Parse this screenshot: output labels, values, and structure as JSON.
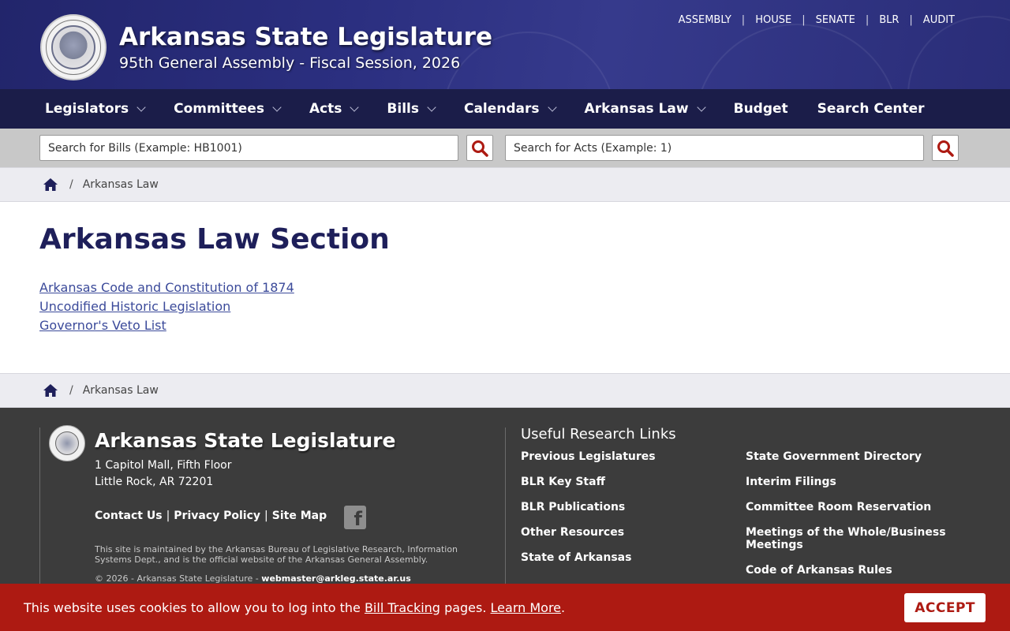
{
  "header": {
    "title": "Arkansas State Legislature",
    "subtitle": "95th General Assembly - Fiscal Session, 2026",
    "top_links": [
      "ASSEMBLY",
      "HOUSE",
      "SENATE",
      "BLR",
      "AUDIT"
    ],
    "colors": {
      "header_bg": "#2b2f80",
      "nav_bg": "#1b1d49"
    }
  },
  "nav": {
    "items": [
      {
        "label": "Legislators",
        "dropdown": true
      },
      {
        "label": "Committees",
        "dropdown": true
      },
      {
        "label": "Acts",
        "dropdown": true
      },
      {
        "label": "Bills",
        "dropdown": true
      },
      {
        "label": "Calendars",
        "dropdown": true
      },
      {
        "label": "Arkansas Law",
        "dropdown": true
      },
      {
        "label": "Budget",
        "dropdown": false
      },
      {
        "label": "Search Center",
        "dropdown": false
      }
    ]
  },
  "search": {
    "bills_placeholder": "Search for Bills (Example: HB1001)",
    "acts_placeholder": "Search for Acts (Example: 1)",
    "button_icon": "search-icon",
    "button_color": "#ad1a12"
  },
  "breadcrumb": {
    "home_icon": "home-icon",
    "current": "Arkansas Law"
  },
  "main": {
    "title": "Arkansas Law Section",
    "links": [
      "Arkansas Code and Constitution of 1874",
      "Uncodified Historic Legislation",
      "Governor's Veto List"
    ]
  },
  "footer": {
    "title": "Arkansas State Legislature",
    "address_line1": "1 Capitol Mall, Fifth Floor",
    "address_line2": "Little Rock, AR 72201",
    "links": [
      "Contact Us",
      "Privacy Policy",
      "Site Map"
    ],
    "social_icon": "facebook-icon",
    "note": "This site is maintained by the Arkansas Bureau of Legislative Research, Information Systems Dept., and is the official website of the Arkansas General Assembly.",
    "copyright": "© 2026 - Arkansas State Legislature -",
    "email": "webmaster@arkleg.state.ar.us",
    "research_title": "Useful Research Links",
    "research_col1": [
      "Previous Legislatures",
      "BLR Key Staff",
      "BLR Publications",
      "Other Resources",
      "State of Arkansas"
    ],
    "research_col2": [
      "State Government Directory",
      "Interim Filings",
      "Committee Room Reservation",
      "Meetings of the Whole/Business Meetings",
      "Code of Arkansas Rules"
    ]
  },
  "cookie": {
    "text_before": "This website uses cookies to allow you to log into the",
    "link1": "Bill Tracking",
    "text_mid": "pages.",
    "link2": "Learn More",
    "text_after": ".",
    "accept_label": "ACCEPT",
    "bg_color": "#ad1a12"
  }
}
